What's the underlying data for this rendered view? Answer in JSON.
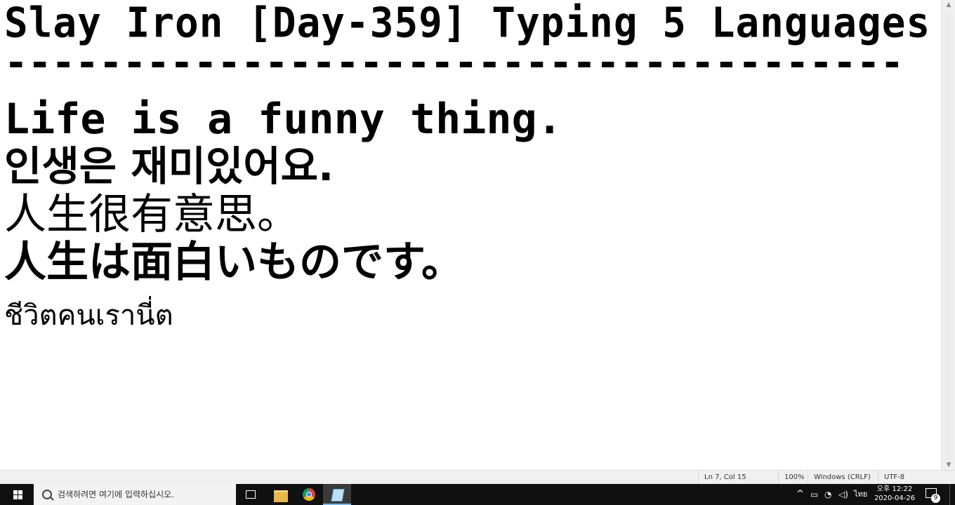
{
  "editor": {
    "lines": [
      "Slay Iron [Day-359] Typing 5 Languages",
      "--------------------------------------",
      "Life is a funny thing.",
      "인생은 재미있어요.",
      "人生很有意思。",
      "人生は面白いものです。",
      "ชีวิตคนเรานี่ต"
    ]
  },
  "statusbar": {
    "position": "Ln 7, Col 15",
    "zoom": "100%",
    "line_ending": "Windows (CRLF)",
    "encoding": "UTF-8"
  },
  "taskbar": {
    "search_placeholder": "검색하려면 여기에 입력하십시오.",
    "apps": [
      "task-view-icon",
      "file-explorer-icon",
      "chrome-icon",
      "notepad-icon"
    ],
    "tray": {
      "chevron": "^",
      "language": "ไทย",
      "time": "오후 12:22",
      "date": "2020-04-26",
      "notification_count": "9"
    }
  }
}
